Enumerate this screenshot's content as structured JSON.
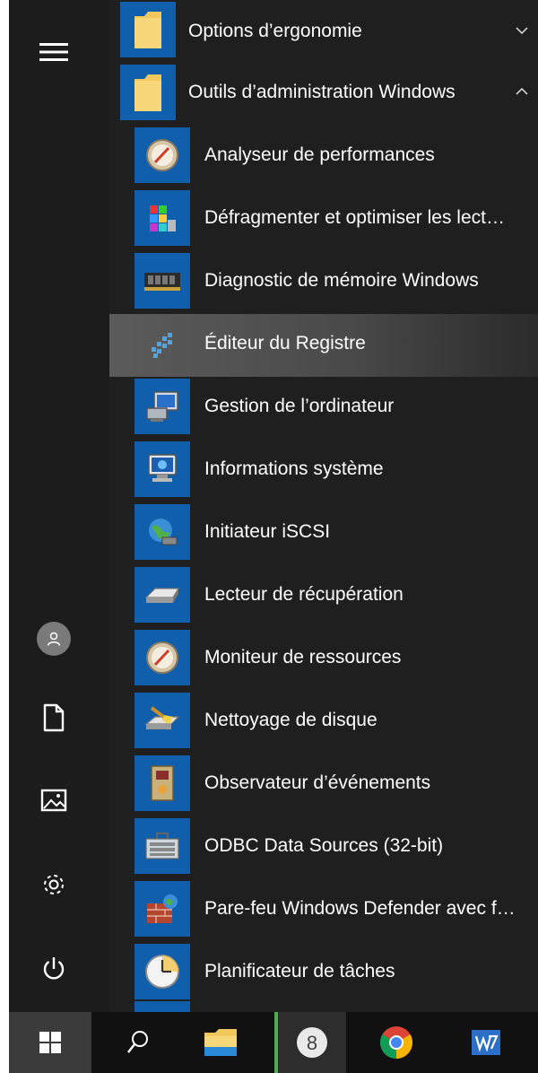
{
  "start_menu": {
    "folders": [
      {
        "label": "Options d’ergonomie",
        "icon": "folder-icon",
        "expanded": false,
        "chevron": "chevron-down-icon"
      },
      {
        "label": "Outils d’administration Windows",
        "icon": "folder-icon",
        "expanded": true,
        "chevron": "chevron-up-icon"
      }
    ],
    "apps": [
      {
        "label": "Analyseur de performances",
        "icon": "performance-monitor-icon"
      },
      {
        "label": "Défragmenter et optimiser les lect…",
        "icon": "defragment-icon"
      },
      {
        "label": "Diagnostic de mémoire Windows",
        "icon": "memory-chip-icon"
      },
      {
        "label": "Éditeur du Registre",
        "icon": "registry-editor-icon",
        "selected": true
      },
      {
        "label": "Gestion de l’ordinateur",
        "icon": "computer-management-icon"
      },
      {
        "label": "Informations système",
        "icon": "system-info-icon"
      },
      {
        "label": "Initiateur iSCSI",
        "icon": "iscsi-globe-icon"
      },
      {
        "label": "Lecteur de récupération",
        "icon": "recovery-drive-icon"
      },
      {
        "label": "Moniteur de ressources",
        "icon": "resource-monitor-icon"
      },
      {
        "label": "Nettoyage de disque",
        "icon": "disk-cleanup-icon"
      },
      {
        "label": "Observateur d’événements",
        "icon": "event-viewer-icon"
      },
      {
        "label": "ODBC Data Sources (32-bit)",
        "icon": "odbc-icon"
      },
      {
        "label": "Pare-feu Windows Defender avec f…",
        "icon": "firewall-icon"
      },
      {
        "label": "Planificateur de tâches",
        "icon": "task-scheduler-clock-icon"
      }
    ]
  },
  "left_rail": [
    "hamburger-menu-icon",
    "user-avatar-icon",
    "documents-icon",
    "pictures-icon",
    "settings-gear-icon",
    "power-icon"
  ],
  "taskbar": [
    "windows-start-icon",
    "search-icon",
    "file-explorer-icon",
    "app-8-icon",
    "chrome-icon",
    "wps-writer-icon"
  ],
  "colors": {
    "background": "#1f1f1f",
    "tile": "#0f5fad",
    "folder": "#f2c75c",
    "selected": "#4e4e4e",
    "text": "#ffffff"
  }
}
